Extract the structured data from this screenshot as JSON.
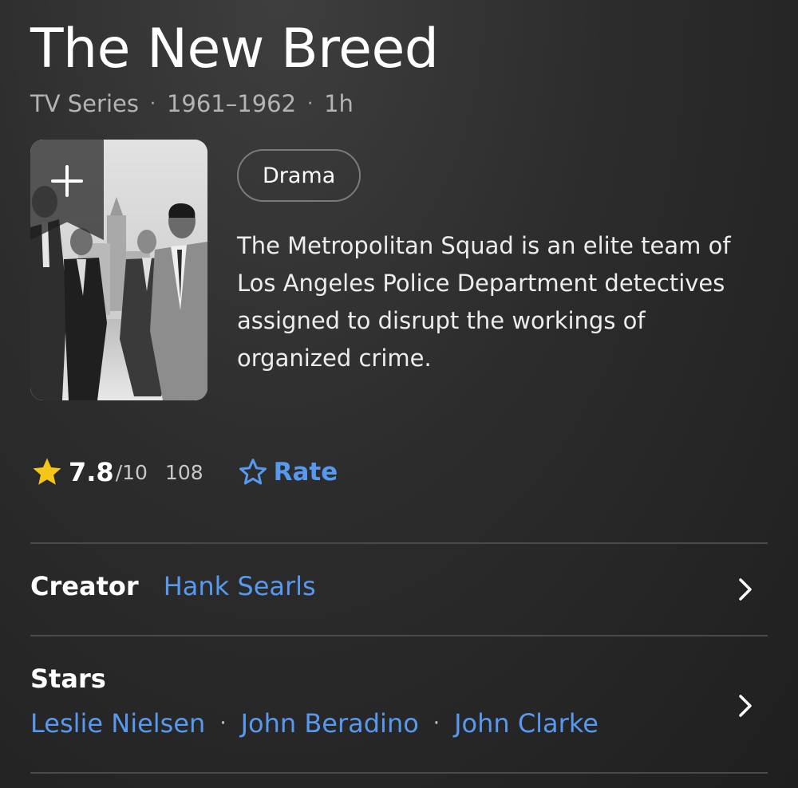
{
  "title": "The New Breed",
  "meta": {
    "type": "TV Series",
    "years": "1961–1962",
    "runtime": "1h"
  },
  "poster": {
    "add_icon": "plus-icon"
  },
  "genre": "Drama",
  "plot": "The Metropolitan Squad is an elite team of Los Angeles Police Department detectives assigned to disrupt the workings of organized crime.",
  "rating": {
    "value": "7.8",
    "max": "/10",
    "votes": "108",
    "rate_label": "Rate",
    "star_color": "#f5c518",
    "accent_color": "#5799ef"
  },
  "creator": {
    "label": "Creator",
    "name": "Hank Searls"
  },
  "stars": {
    "label": "Stars",
    "names": [
      "Leslie Nielsen",
      "John Beradino",
      "John Clarke"
    ]
  }
}
